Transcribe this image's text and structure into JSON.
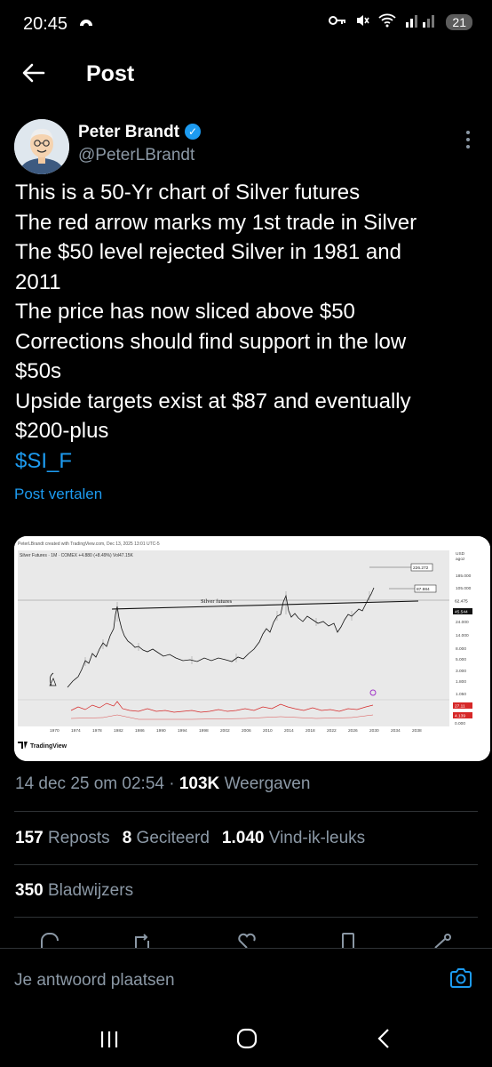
{
  "status_bar": {
    "time": "20:45",
    "battery": "21"
  },
  "header": {
    "title": "Post"
  },
  "author": {
    "name": "Peter Brandt",
    "handle": "@PeterLBrandt"
  },
  "tweet": {
    "lines": [
      "This is a 50-Yr chart of Silver futures",
      "The red arrow marks my 1st trade in Silver",
      "The $50 level rejected Silver in 1981 and",
      "2011",
      "The price has now sliced above $50",
      "Corrections should find support in the low",
      "$50s",
      "Upside targets exist at $87 and eventually",
      "$200-plus"
    ],
    "cashtag": "$SI_F",
    "translate_label": "Post vertalen"
  },
  "chart": {
    "credit": "PeterLBrandt created with TradingView.com, Dec 13, 2025 13:01 UTC-5",
    "symbol": "Silver Futures · 1M · COMEX +4.880 (+8.49%) Vol47.15K",
    "annotation": "Silver futures",
    "target_high": "226.272",
    "target_mid": "87.984",
    "currency": "USD",
    "currency_sub": "agoz",
    "price_labels": [
      "185.000",
      "105.000",
      "62.475",
      "45.544",
      "24.000",
      "14.000",
      "8.000",
      "5.000",
      "3.000",
      "1.800",
      "1.050"
    ],
    "indicator_labels": [
      "27.11",
      "4.139",
      "0.000"
    ],
    "x_labels": [
      "1970",
      "1974",
      "1978",
      "1982",
      "1986",
      "1990",
      "1994",
      "1998",
      "2002",
      "2006",
      "2010",
      "2014",
      "2018",
      "2022",
      "2026",
      "2030",
      "2034",
      "2038"
    ],
    "brand": "TradingView"
  },
  "meta": {
    "timestamp": "14 dec 25 om 02:54",
    "separator": "·",
    "views_count": "103K",
    "views_label": "Weergaven"
  },
  "stats": {
    "reposts_count": "157",
    "reposts_label": "Reposts",
    "quotes_count": "8",
    "quotes_label": "Geciteerd",
    "likes_count": "1.040",
    "likes_label": "Vind-ik-leuks",
    "bookmarks_count": "350",
    "bookmarks_label": "Bladwijzers"
  },
  "reply": {
    "placeholder": "Je antwoord plaatsen"
  },
  "icons": [
    "wifi-icon",
    "signal-icon",
    "mute-icon",
    "key-icon",
    "back-arrow-icon",
    "verified-icon",
    "more-icon",
    "reply-icon",
    "repost-icon",
    "like-icon",
    "bookmark-icon",
    "share-icon",
    "camera-icon",
    "recents-icon",
    "home-icon",
    "back-nav-icon"
  ],
  "colors": {
    "accent": "#1d9bf0",
    "background": "#000000",
    "muted": "#8b98a5"
  }
}
